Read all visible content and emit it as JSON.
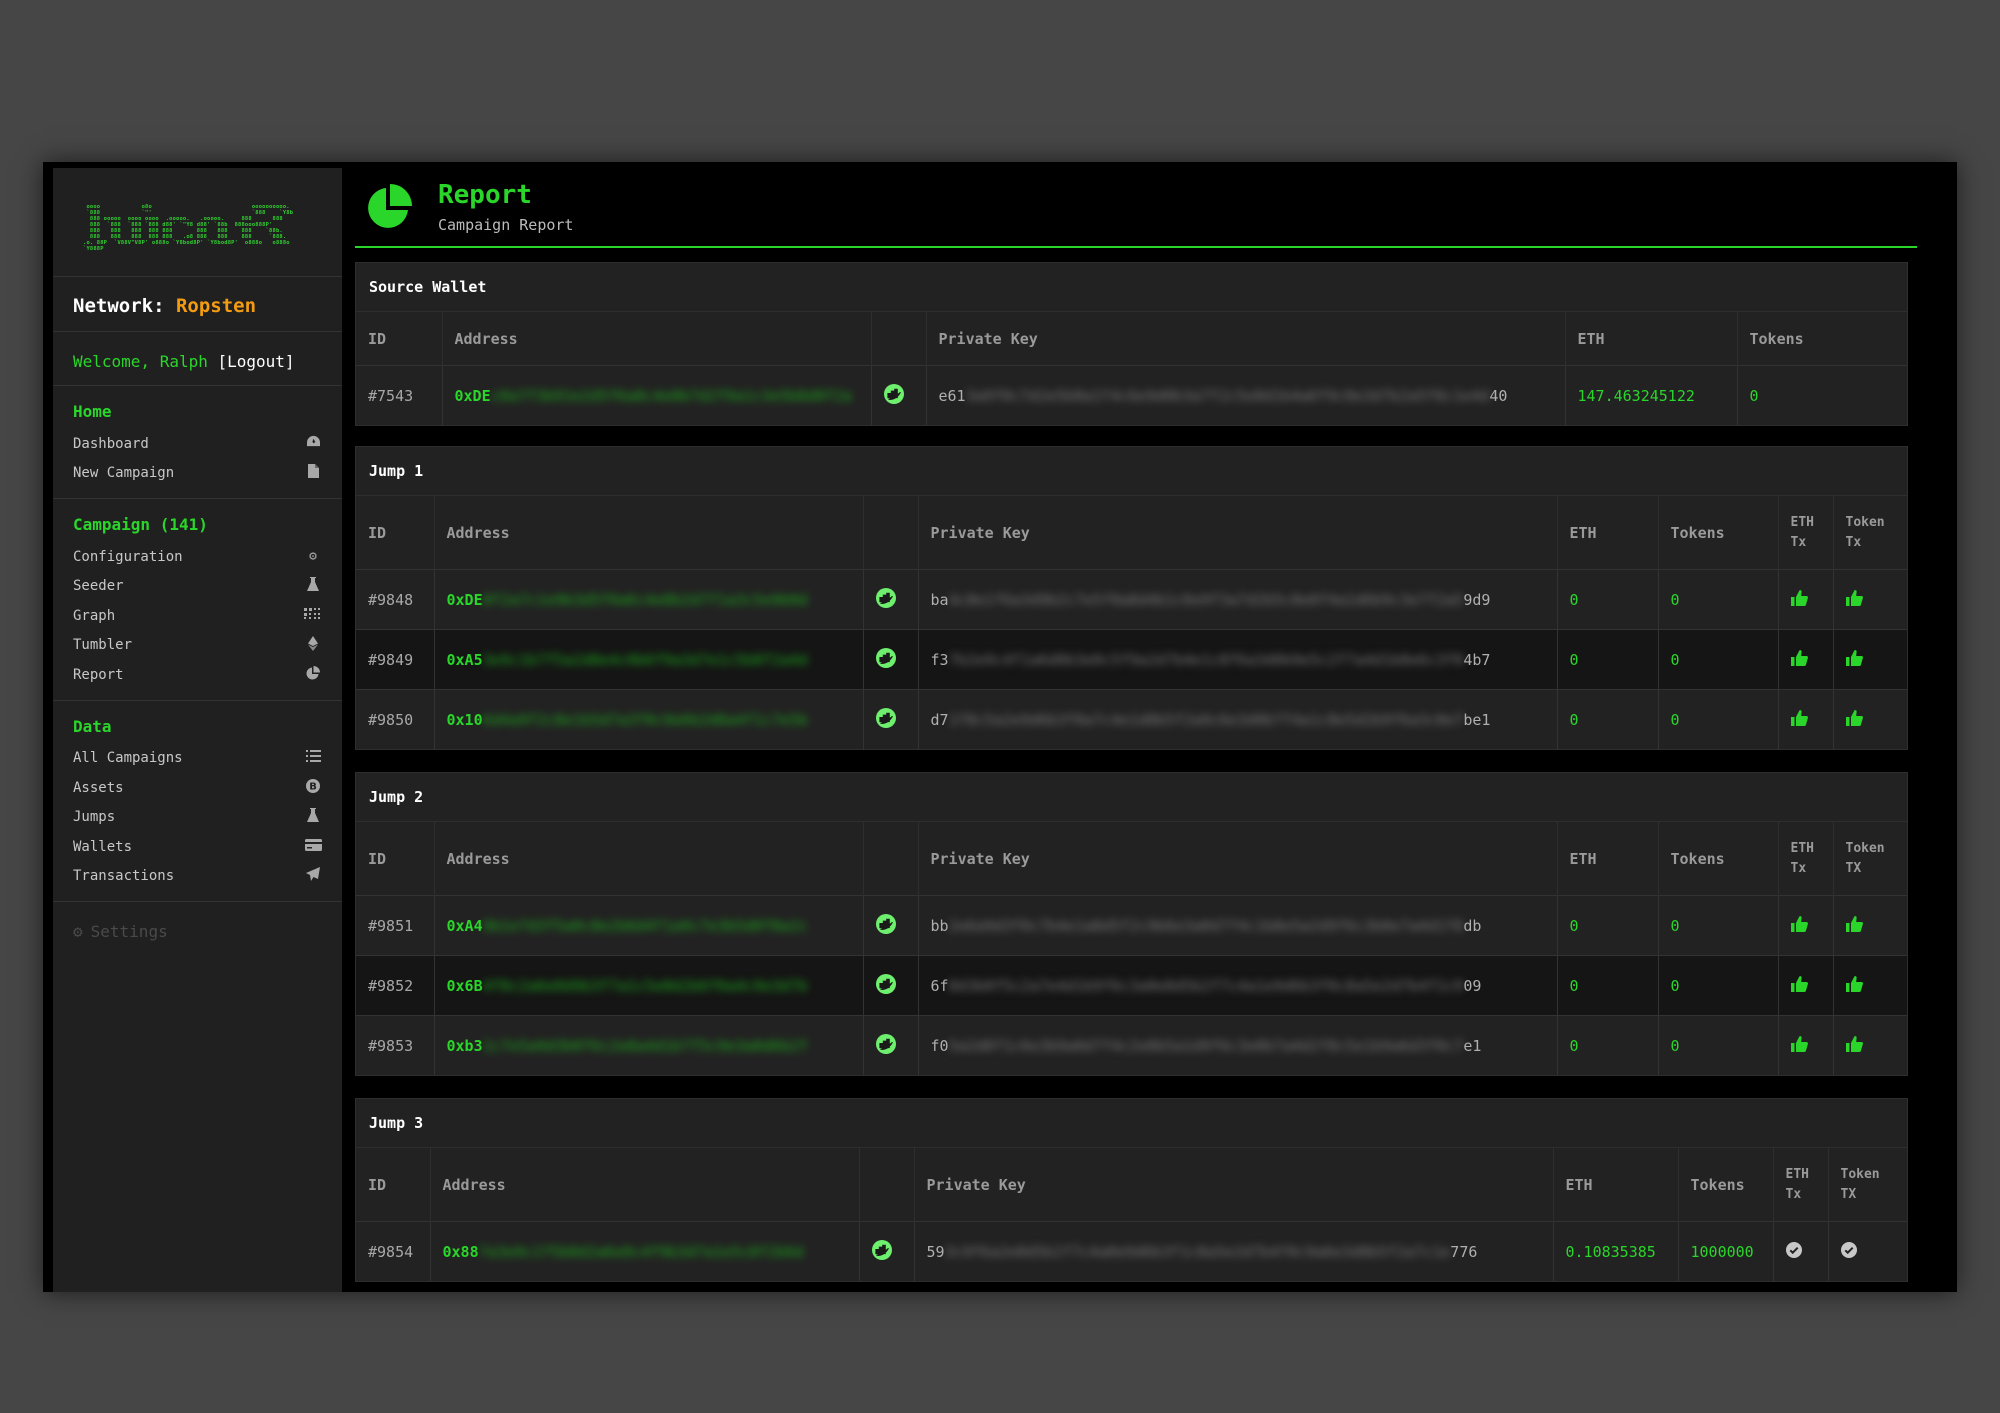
{
  "sidebar": {
    "logo_text": " oooo            o8o                             oooooooooo.\n `888            `\"'                             `888    `Y8b\n  888 ooooo  oooo oooo  .ooooo.   .ooooo.     888      888\n  888  `888  `888 `888 d88' `\"Y8 d88' `88b  888ooo888P'\n  888   888   888  888 888       888   888    888    `88b.\n  888   888   888  888 888   .o8 888   888    888     `888.\n.o. 88P  `V88V\"V8P' o888o `Y8bod8P' `Y8bod8P'  o888o   o888o\n`Y888P",
    "network_label": "Network:",
    "network_value": "Ropsten",
    "welcome_text": "Welcome, Ralph",
    "logout_label": "[Logout]",
    "sections": [
      {
        "title": "Home",
        "items": [
          {
            "label": "Dashboard",
            "icon": "dashboard-icon"
          },
          {
            "label": "New Campaign",
            "icon": "file-icon"
          }
        ]
      },
      {
        "title": "Campaign (141)",
        "items": [
          {
            "label": "Configuration",
            "icon": "gear-icon"
          },
          {
            "label": "Seeder",
            "icon": "flask-icon"
          },
          {
            "label": "Graph",
            "icon": "grid-icon"
          },
          {
            "label": "Tumbler",
            "icon": "ethereum-icon"
          },
          {
            "label": "Report",
            "icon": "pie-chart-icon"
          }
        ]
      },
      {
        "title": "Data",
        "items": [
          {
            "label": "All Campaigns",
            "icon": "list-icon"
          },
          {
            "label": "Assets",
            "icon": "bitcoin-icon"
          },
          {
            "label": "Jumps",
            "icon": "flask-icon"
          },
          {
            "label": "Wallets",
            "icon": "credit-card-icon"
          },
          {
            "label": "Transactions",
            "icon": "paper-plane-icon"
          }
        ]
      }
    ],
    "settings_label": "Settings"
  },
  "header": {
    "title": "Report",
    "subtitle": "Campaign Report"
  },
  "source_wallet": {
    "title": "Source Wallet",
    "columns": [
      "ID",
      "Address",
      "",
      "Private Key",
      "ETH",
      "Tokens"
    ],
    "row": {
      "id": "#7543",
      "addr_start": "0xDE",
      "addr_blur": "c0a7f3b91e2d5f6a8c4e0b7d2f9a1c3e5b8d0f2a",
      "key_start": "e61",
      "key_blur": "3a9f0c7d2e5b8a1f4c6e9d0b3a7f2c5e8d1b4a6f9c0e3d7b2a5f8c1e4d",
      "key_end": "40",
      "eth": "147.463245122",
      "tokens": "0"
    }
  },
  "jumps": [
    {
      "title": "Jump 1",
      "columns": [
        "ID",
        "Address",
        "",
        "Private Key",
        "ETH",
        "Tokens",
        "ETH Tx",
        "Token Tx"
      ],
      "rows": [
        {
          "id": "#9848",
          "addr_start": "0xDE",
          "addr_blur": "8f2a7c1e9b3d5f0a6c4e8b2d7f1a3c5e9b0d",
          "key_start": "ba",
          "key_blur": "4c8e1f6a3d9b2c7e5f0a8d4b1c6e9f3a7d2b5c8e0f4a1d6b9c3e7f2a5",
          "key_end": "9d9",
          "eth": "0",
          "tokens": "0",
          "eth_tx": "thumbs-up-icon",
          "token_tx": "thumbs-up-icon"
        },
        {
          "id": "#9849",
          "addr_start": "0xA5",
          "addr_blur": "3e9c1b7f5a2d8e4c0b6f9a3d7e1c5b8f2a4d",
          "key_start": "f3",
          "key_blur": "7b2e9c4f1a6d8b3e0c5f9a2d7b4e1c8f6a3d0b9e5c2f7a4d1b8e6c3f0",
          "key_end": "4b7",
          "eth": "0",
          "tokens": "0",
          "eth_tx": "thumbs-up-icon",
          "token_tx": "thumbs-up-icon"
        },
        {
          "id": "#9850",
          "addr_start": "0x10",
          "addr_blur": "6d4a9f2c8e1b5d7a3f0c9e6b2d8a4f1c7e5b",
          "key_start": "d7",
          "key_blur": "1f8c5a2e9d6b3f0a7c4e1d8b5f2a9c6e3d0b7f4a1c8e5d2b9f6a3c0e7",
          "key_end": "be1",
          "eth": "0",
          "tokens": "0",
          "eth_tx": "thumbs-up-icon",
          "token_tx": "thumbs-up-icon"
        }
      ]
    },
    {
      "title": "Jump 2",
      "columns": [
        "ID",
        "Address",
        "",
        "Private Key",
        "ETH",
        "Tokens",
        "ETH Tx",
        "Token TX"
      ],
      "rows": [
        {
          "id": "#9851",
          "addr_start": "0xA4",
          "addr_blur": "9b1e7d3f5a0c8e2b6d4f1a9c7e3b5d0f8a2c",
          "key_start": "bb",
          "key_blur": "2e6a9d3f0c7b4e1a8d5f2c9b6e3a0d7f4c1b8e5a2d9f6c3b0e7a4d1f8",
          "key_end": "db",
          "eth": "0",
          "tokens": "0",
          "eth_tx": "thumbs-up-icon",
          "token_tx": "thumbs-up-icon"
        },
        {
          "id": "#9852",
          "addr_start": "0x6B",
          "addr_blur": "4f8c2a6e0d9b3f7a1c5e8d2b6f0a4c9e3d7b",
          "key_start": "6f",
          "key_blur": "8d3b0f5c2a7e4d1b9f6c3a0e8d5b2f7c4a1e9d6b3f0c8a5e2d7b4f1c9",
          "key_end": "09",
          "eth": "0",
          "tokens": "0",
          "eth_tx": "thumbs-up-icon",
          "token_tx": "thumbs-up-icon"
        },
        {
          "id": "#9853",
          "addr_start": "0xb3",
          "addr_blur": "1c7e5a9d3b0f6c2e8a4d1b7f5c9e3a0d6b2f",
          "key_start": "f0",
          "key_blur": "5a2d8f1c6e3b9a0d7f4c2e8b5a1d9f6c3e0b7a4d2f8c5e1b9a6d3f0c7",
          "key_end": "e1",
          "eth": "0",
          "tokens": "0",
          "eth_tx": "thumbs-up-icon",
          "token_tx": "thumbs-up-icon"
        }
      ]
    },
    {
      "title": "Jump 3",
      "columns": [
        "ID",
        "Address",
        "",
        "Private Key",
        "ETH",
        "Tokens",
        "ETH Tx",
        "Token TX"
      ],
      "rows": [
        {
          "id": "#9854",
          "addr_start": "0x88",
          "addr_blur": "7a3e9c1f5b8d2a6e0c4f9b3d7a1e5c8f2b6d",
          "key_start": "59",
          "key_blur": "3c9f6a2e8d5b1f7c4a0e9d6b3f1c8a5e2d7b4f0c9a6e3d8b5f2a7c1e",
          "key_end": "776",
          "eth": "0.10835385",
          "tokens": "1000000",
          "eth_tx": "check-circle-icon",
          "token_tx": "check-circle-icon"
        }
      ]
    }
  ],
  "colors": {
    "accent": "#2ad62a",
    "network": "#f39c12",
    "background": "#000000",
    "panel": "#222222"
  }
}
